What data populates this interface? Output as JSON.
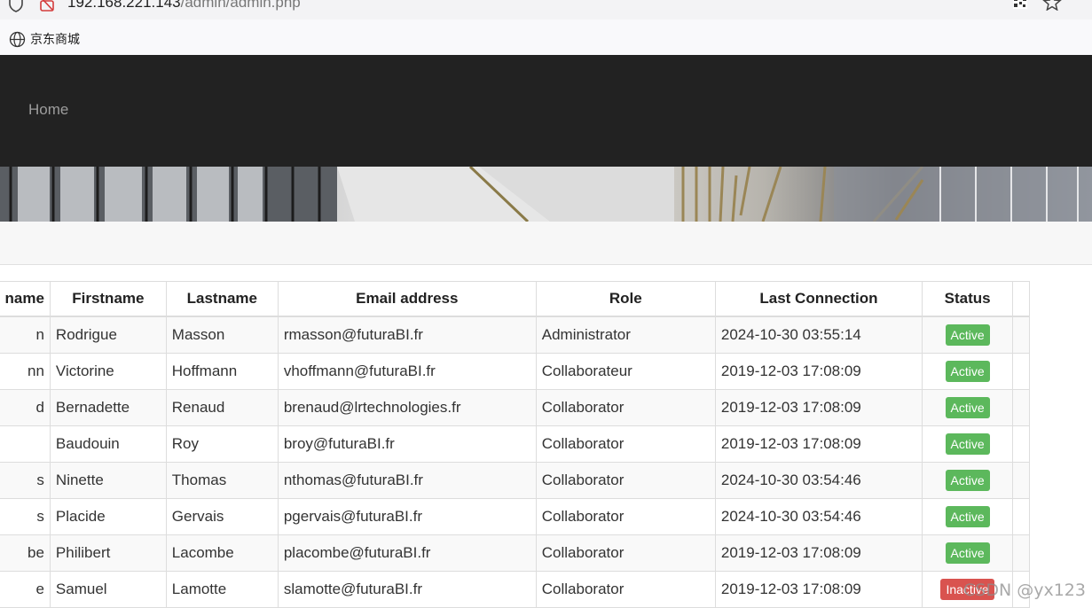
{
  "browser": {
    "url_host": "192.168.221.143",
    "url_path": "/admin/admin.php",
    "bookmark_label": "京东商城"
  },
  "nav": {
    "home_label": "Home"
  },
  "table": {
    "headers": [
      "name",
      "Firstname",
      "Lastname",
      "Email address",
      "Role",
      "Last Connection",
      "Status"
    ],
    "rows": [
      {
        "username": "n",
        "firstname": "Rodrigue",
        "lastname": "Masson",
        "email": "rmasson@futuraBI.fr",
        "role": "Administrator",
        "last_connection": "2024-10-30 03:55:14",
        "status": "Active"
      },
      {
        "username": "nn",
        "firstname": "Victorine",
        "lastname": "Hoffmann",
        "email": "vhoffmann@futuraBI.fr",
        "role": "Collaborateur",
        "last_connection": "2019-12-03 17:08:09",
        "status": "Active"
      },
      {
        "username": "d",
        "firstname": "Bernadette",
        "lastname": "Renaud",
        "email": "brenaud@lrtechnologies.fr",
        "role": "Collaborator",
        "last_connection": "2019-12-03 17:08:09",
        "status": "Active"
      },
      {
        "username": "",
        "firstname": "Baudouin",
        "lastname": "Roy",
        "email": "broy@futuraBI.fr",
        "role": "Collaborator",
        "last_connection": "2019-12-03 17:08:09",
        "status": "Active"
      },
      {
        "username": "s",
        "firstname": "Ninette",
        "lastname": "Thomas",
        "email": "nthomas@futuraBI.fr",
        "role": "Collaborator",
        "last_connection": "2024-10-30 03:54:46",
        "status": "Active"
      },
      {
        "username": "s",
        "firstname": "Placide",
        "lastname": "Gervais",
        "email": "pgervais@futuraBI.fr",
        "role": "Collaborator",
        "last_connection": "2024-10-30 03:54:46",
        "status": "Active"
      },
      {
        "username": "be",
        "firstname": "Philibert",
        "lastname": "Lacombe",
        "email": "placombe@futuraBI.fr",
        "role": "Collaborator",
        "last_connection": "2019-12-03 17:08:09",
        "status": "Active"
      },
      {
        "username": "e",
        "firstname": "Samuel",
        "lastname": "Lamotte",
        "email": "slamotte@futuraBI.fr",
        "role": "Collaborator",
        "last_connection": "2019-12-03 17:08:09",
        "status": "Inactive"
      }
    ]
  },
  "watermark": "CSDN @yx123",
  "colors": {
    "navbar": "#222222",
    "active": "#5cb85c",
    "inactive": "#d9534f"
  }
}
